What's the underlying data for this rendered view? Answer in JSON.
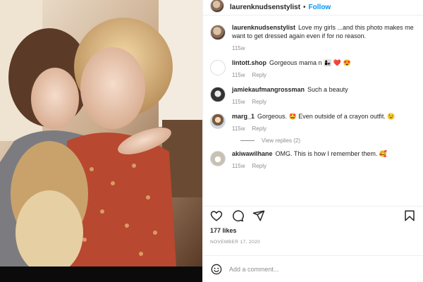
{
  "post": {
    "username": "laurenknudsenstylist",
    "separator": "•",
    "follow_label": "Follow",
    "caption": {
      "username": "laurenknudsenstylist",
      "text": "Love my girls ...and this photo makes me want to get dressed again even if for no reason.",
      "time": "115w"
    },
    "comments": [
      {
        "username": "lintott.shop",
        "text": "Gorgeous mama n 👩‍👧 ❤️ 😍",
        "time": "115w",
        "reply": "Reply",
        "avatar": "shop-logo"
      },
      {
        "username": "jamiekaufmangrossman",
        "text": "Such a beauty",
        "time": "115w",
        "reply": "Reply",
        "avatar": "profile-photo"
      },
      {
        "username": "marg_1",
        "text": "Gorgeous. 🤩 Even outside of a crayon outfit. 😉",
        "time": "115w",
        "reply": "Reply",
        "avatar": "profile-photo"
      },
      {
        "username": "akiwawilhane",
        "text": "OMG. This is how I remember them. 🥰",
        "time": "115w",
        "reply": "Reply",
        "avatar": "profile-photo"
      }
    ],
    "view_replies": "View replies (2)",
    "likes": "177 likes",
    "date": "NOVEMBER 17, 2020",
    "add_comment_placeholder": "Add a comment...",
    "icons": {
      "like": "heart-icon",
      "comment": "comment-icon",
      "share": "share-icon",
      "save": "bookmark-icon",
      "emoji": "smile-icon"
    }
  }
}
